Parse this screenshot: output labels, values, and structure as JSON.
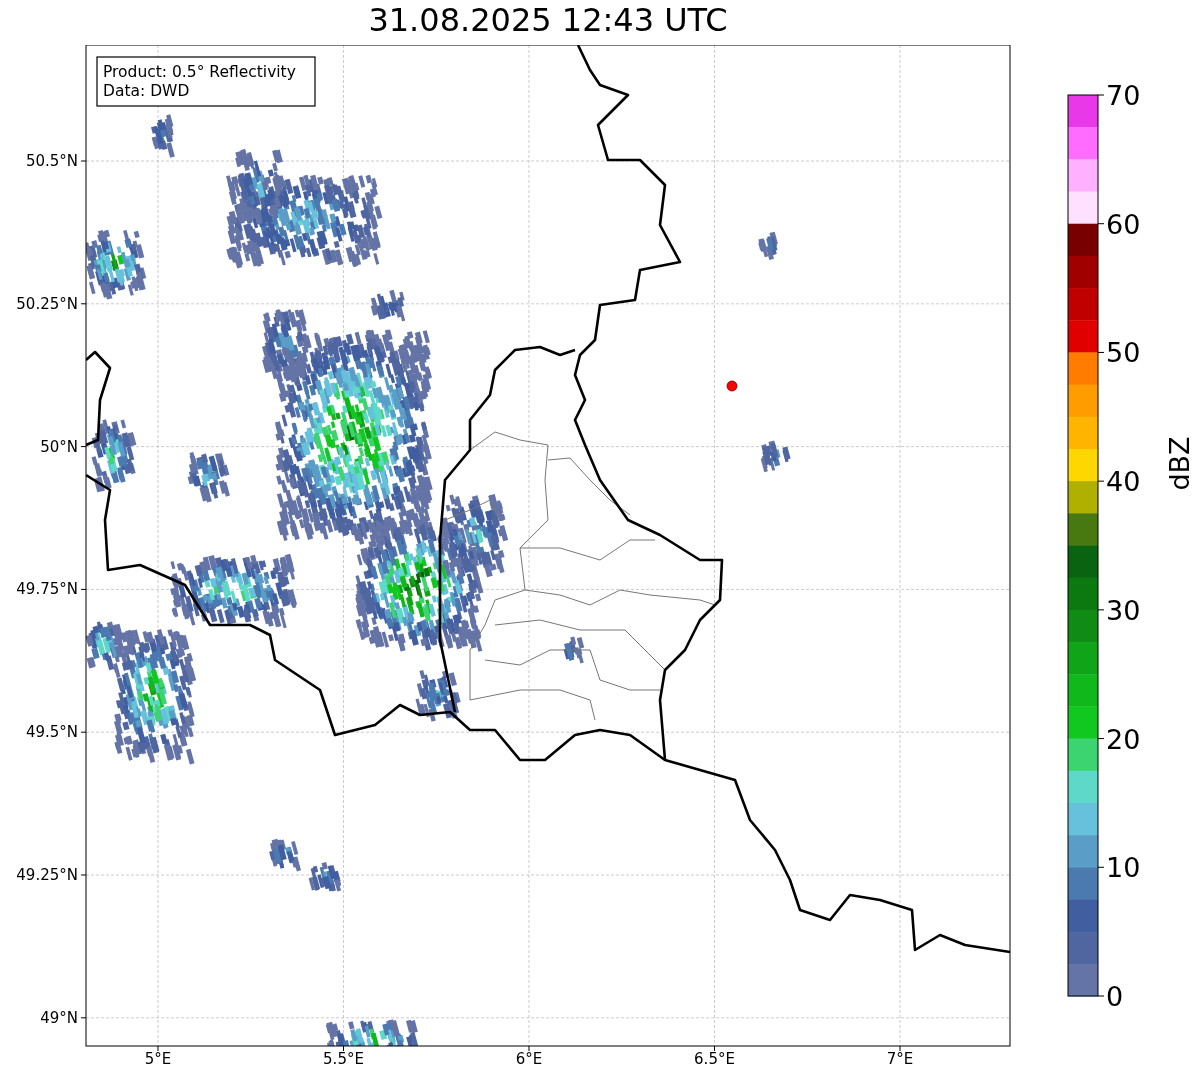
{
  "title": "31.08.2025 12:43 UTC",
  "info_box": {
    "lines": [
      "Product: 0.5° Reflectivity",
      "Data: DWD"
    ]
  },
  "map": {
    "lon_ticks": [
      "5°E",
      "5.5°E",
      "6°E",
      "6.5°E",
      "7°E"
    ],
    "lat_ticks": [
      "50.5°N",
      "50.25°N",
      "50°N",
      "49.75°N",
      "49.5°N",
      "49.25°N",
      "49°N"
    ]
  },
  "colorbar": {
    "label": "dBZ",
    "ticks": [
      "70",
      "60",
      "50",
      "40",
      "30",
      "20",
      "10",
      "0"
    ],
    "bins": [
      {
        "color": "#e838e8"
      },
      {
        "color": "#ff6cff"
      },
      {
        "color": "#ffb0ff"
      },
      {
        "color": "#ffe0ff"
      },
      {
        "color": "#780000"
      },
      {
        "color": "#a00000"
      },
      {
        "color": "#c00000"
      },
      {
        "color": "#e00000"
      },
      {
        "color": "#ff7c00"
      },
      {
        "color": "#ff9c00"
      },
      {
        "color": "#ffb400"
      },
      {
        "color": "#ffd700"
      },
      {
        "color": "#b0b000"
      },
      {
        "color": "#487810"
      },
      {
        "color": "#086410"
      },
      {
        "color": "#0c7810"
      },
      {
        "color": "#108c14"
      },
      {
        "color": "#10a418"
      },
      {
        "color": "#10b81c"
      },
      {
        "color": "#10c820"
      },
      {
        "color": "#3cd470"
      },
      {
        "color": "#5ed8c8"
      },
      {
        "color": "#66c2dc"
      },
      {
        "color": "#5a9ec8"
      },
      {
        "color": "#4a7ab0"
      },
      {
        "color": "#405ea0"
      },
      {
        "color": "#5066a0"
      },
      {
        "color": "#6574a6"
      }
    ]
  }
}
